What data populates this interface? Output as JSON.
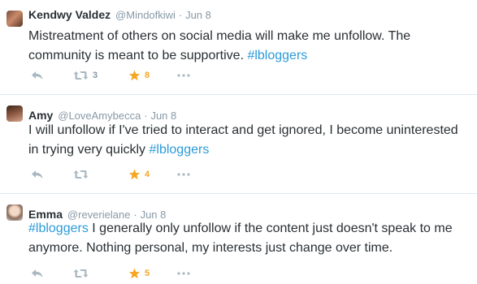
{
  "tweets": [
    {
      "name": "Kendwy Valdez",
      "handle": "@Mindofkiwi",
      "separator": "·",
      "date": "Jun 8",
      "text_before": "Mistreatment of others on social media will make me unfollow. The community is meant to be supportive. ",
      "hashtag": "#lbloggers",
      "text_after": "",
      "retweets": "3",
      "favorites": "8"
    },
    {
      "name": "Amy",
      "handle": "@LoveAmybecca",
      "separator": "·",
      "date": "Jun 8",
      "text_before": "I will unfollow if I've tried to interact and get ignored, I become uninterested in trying very quickly ",
      "hashtag": "#lbloggers",
      "text_after": "",
      "retweets": "",
      "favorites": "4"
    },
    {
      "name": "Emma",
      "handle": "@reverielane",
      "separator": "·",
      "date": "Jun 8",
      "text_before": "",
      "hashtag": "#lbloggers",
      "text_after": " I generally only unfollow if the content just doesn't speak to me anymore. Nothing personal, my interests just change over time.",
      "retweets": "",
      "favorites": "5"
    }
  ],
  "icons": {
    "reply": "reply-arrow-icon",
    "retweet": "retweet-icon",
    "favorite": "star-icon",
    "more": "more-dots-icon"
  },
  "colors": {
    "name": "#292f33",
    "meta": "#8899a6",
    "hashtag": "#2b9bd8",
    "favorite": "#f5a623",
    "action_icon": "#aab8c2",
    "divider": "#e1e8ed"
  }
}
